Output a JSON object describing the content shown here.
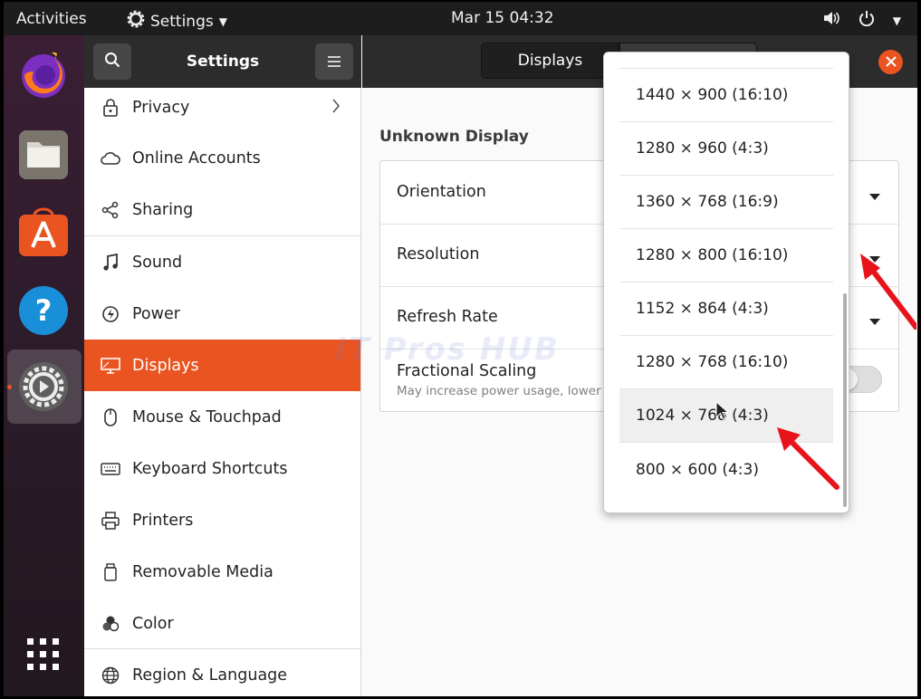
{
  "topbar": {
    "activities": "Activities",
    "app_name": "Settings",
    "clock": "Mar 15  04:32"
  },
  "dock": {
    "items": [
      "firefox-icon",
      "files-icon",
      "software-icon",
      "help-icon",
      "settings-icon",
      "app-grid-icon"
    ]
  },
  "header": {
    "title": "Settings",
    "tab_displays": "Displays"
  },
  "sidebar": {
    "items": [
      {
        "label": "Privacy",
        "icon": "lock-icon"
      },
      {
        "label": "Online Accounts",
        "icon": "cloud-icon"
      },
      {
        "label": "Sharing",
        "icon": "share-icon"
      },
      {
        "label": "Sound",
        "icon": "music-note-icon"
      },
      {
        "label": "Power",
        "icon": "power-icon"
      },
      {
        "label": "Displays",
        "icon": "display-icon"
      },
      {
        "label": "Mouse & Touchpad",
        "icon": "mouse-icon"
      },
      {
        "label": "Keyboard Shortcuts",
        "icon": "keyboard-icon"
      },
      {
        "label": "Printers",
        "icon": "printer-icon"
      },
      {
        "label": "Removable Media",
        "icon": "removable-media-icon"
      },
      {
        "label": "Color",
        "icon": "color-icon"
      },
      {
        "label": "Region & Language",
        "icon": "globe-icon"
      }
    ],
    "active": "Displays"
  },
  "main": {
    "display_name": "Unknown Display",
    "rows": {
      "orientation": "Orientation",
      "resolution": "Resolution",
      "refresh_rate": "Refresh Rate",
      "fractional_scaling": "Fractional Scaling",
      "fractional_scaling_note": "May increase power usage, lower"
    },
    "watermark": "IT Pros HUB"
  },
  "resolution_dropdown": {
    "options": [
      "1440 × 900 (16:10)",
      "1280 × 960 (4:3)",
      "1360 × 768 (16:9)",
      "1280 × 800 (16:10)",
      "1152 × 864 (4:3)",
      "1280 × 768 (16:10)",
      "1024 × 768 (4:3)",
      "800 × 600 (4:3)"
    ],
    "hovered": "1024 × 768 (4:3)"
  },
  "colors": {
    "accent": "#e95420",
    "annotation_arrow": "#e8141b",
    "topbar": "#1d1d1d",
    "header": "#2c2c2c"
  }
}
